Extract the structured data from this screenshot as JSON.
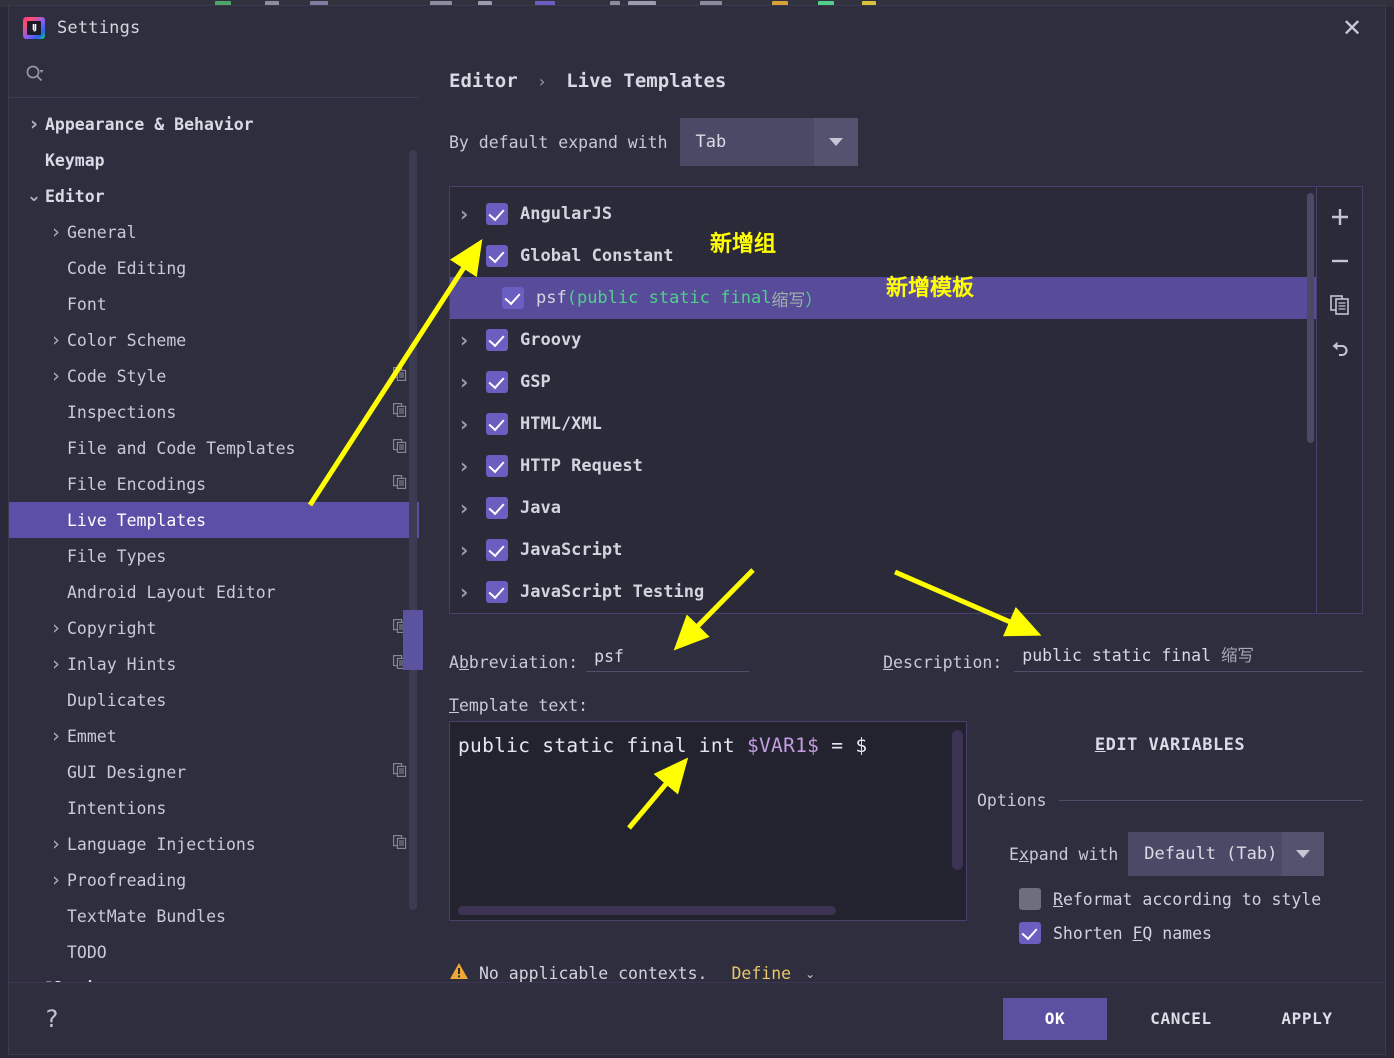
{
  "window": {
    "title": "Settings",
    "logo_text": "IJ",
    "close_icon": "close-icon"
  },
  "search": {
    "value": "",
    "placeholder": ""
  },
  "sidebar": {
    "items": [
      {
        "label": "Appearance & Behavior",
        "chevron": ">",
        "indent": 0,
        "bold": true,
        "selected": false,
        "copy": false
      },
      {
        "label": "Keymap",
        "chevron": "",
        "indent": 0,
        "bold": true,
        "selected": false,
        "copy": false
      },
      {
        "label": "Editor",
        "chevron": "v",
        "indent": 0,
        "bold": true,
        "selected": false,
        "copy": false
      },
      {
        "label": "General",
        "chevron": ">",
        "indent": 1,
        "bold": false,
        "selected": false,
        "copy": false
      },
      {
        "label": "Code Editing",
        "chevron": "",
        "indent": 1,
        "bold": false,
        "selected": false,
        "copy": false
      },
      {
        "label": "Font",
        "chevron": "",
        "indent": 1,
        "bold": false,
        "selected": false,
        "copy": false
      },
      {
        "label": "Color Scheme",
        "chevron": ">",
        "indent": 1,
        "bold": false,
        "selected": false,
        "copy": false
      },
      {
        "label": "Code Style",
        "chevron": ">",
        "indent": 1,
        "bold": false,
        "selected": false,
        "copy": true
      },
      {
        "label": "Inspections",
        "chevron": "",
        "indent": 1,
        "bold": false,
        "selected": false,
        "copy": true
      },
      {
        "label": "File and Code Templates",
        "chevron": "",
        "indent": 1,
        "bold": false,
        "selected": false,
        "copy": true
      },
      {
        "label": "File Encodings",
        "chevron": "",
        "indent": 1,
        "bold": false,
        "selected": false,
        "copy": true
      },
      {
        "label": "Live Templates",
        "chevron": "",
        "indent": 1,
        "bold": false,
        "selected": true,
        "copy": false
      },
      {
        "label": "File Types",
        "chevron": "",
        "indent": 1,
        "bold": false,
        "selected": false,
        "copy": false
      },
      {
        "label": "Android Layout Editor",
        "chevron": "",
        "indent": 1,
        "bold": false,
        "selected": false,
        "copy": false
      },
      {
        "label": "Copyright",
        "chevron": ">",
        "indent": 1,
        "bold": false,
        "selected": false,
        "copy": true
      },
      {
        "label": "Inlay Hints",
        "chevron": ">",
        "indent": 1,
        "bold": false,
        "selected": false,
        "copy": true
      },
      {
        "label": "Duplicates",
        "chevron": "",
        "indent": 1,
        "bold": false,
        "selected": false,
        "copy": false
      },
      {
        "label": "Emmet",
        "chevron": ">",
        "indent": 1,
        "bold": false,
        "selected": false,
        "copy": false
      },
      {
        "label": "GUI Designer",
        "chevron": "",
        "indent": 1,
        "bold": false,
        "selected": false,
        "copy": true
      },
      {
        "label": "Intentions",
        "chevron": "",
        "indent": 1,
        "bold": false,
        "selected": false,
        "copy": false
      },
      {
        "label": "Language Injections",
        "chevron": ">",
        "indent": 1,
        "bold": false,
        "selected": false,
        "copy": true
      },
      {
        "label": "Proofreading",
        "chevron": ">",
        "indent": 1,
        "bold": false,
        "selected": false,
        "copy": false
      },
      {
        "label": "TextMate Bundles",
        "chevron": "",
        "indent": 1,
        "bold": false,
        "selected": false,
        "copy": false
      },
      {
        "label": "TODO",
        "chevron": "",
        "indent": 1,
        "bold": false,
        "selected": false,
        "copy": false
      },
      {
        "label": "Plugins",
        "chevron": "",
        "indent": 0,
        "bold": true,
        "selected": false,
        "copy": false
      }
    ]
  },
  "breadcrumb": {
    "root": "Editor",
    "separator": "›",
    "leaf": "Live Templates"
  },
  "expand_default": {
    "label": "By default expand with",
    "value": "Tab"
  },
  "templates_list": {
    "rows": [
      {
        "kind": "group",
        "chevron": ">",
        "checked": true,
        "label": "AngularJS",
        "selected": false
      },
      {
        "kind": "group",
        "chevron": "v",
        "checked": true,
        "label": "Global Constant",
        "selected": false
      },
      {
        "kind": "template",
        "chevron": "",
        "checked": true,
        "abbr": "psf",
        "desc_open": " (public static final ",
        "desc_cjk": "缩写",
        "desc_close": "）",
        "selected": true
      },
      {
        "kind": "group",
        "chevron": ">",
        "checked": true,
        "label": "Groovy",
        "selected": false
      },
      {
        "kind": "group",
        "chevron": ">",
        "checked": true,
        "label": "GSP",
        "selected": false
      },
      {
        "kind": "group",
        "chevron": ">",
        "checked": true,
        "label": "HTML/XML",
        "selected": false
      },
      {
        "kind": "group",
        "chevron": ">",
        "checked": true,
        "label": "HTTP Request",
        "selected": false
      },
      {
        "kind": "group",
        "chevron": ">",
        "checked": true,
        "label": "Java",
        "selected": false
      },
      {
        "kind": "group",
        "chevron": ">",
        "checked": true,
        "label": "JavaScript",
        "selected": false
      },
      {
        "kind": "group",
        "chevron": ">",
        "checked": true,
        "label": "JavaScript Testing",
        "selected": false
      }
    ],
    "toolbar": [
      {
        "icon": "plus-icon",
        "glyph": "+"
      },
      {
        "icon": "minus-icon",
        "glyph": "−"
      },
      {
        "icon": "duplicate-icon",
        "glyph": "❐"
      },
      {
        "icon": "revert-icon",
        "glyph": "↩"
      }
    ]
  },
  "fields": {
    "abbreviation_label_pre": "A",
    "abbreviation_label_mn": "b",
    "abbreviation_label_post": "breviation:",
    "abbreviation_value": "psf",
    "description_label_mn": "D",
    "description_label_post": "escription:",
    "description_value_ascii": "public static final ",
    "description_value_cjk": "缩写",
    "template_text_label_mn": "T",
    "template_text_label_post": "emplate text:"
  },
  "editor": {
    "code_pre": "public static final int ",
    "code_var": "$VAR1$",
    "code_post": " = $"
  },
  "right_pane": {
    "edit_variables_mn": "E",
    "edit_variables_post": "DIT VARIABLES",
    "options_title": "Options",
    "expand_with_pre": "E",
    "expand_with_mn": "x",
    "expand_with_post": "pand with",
    "expand_with_value": "Default (Tab)",
    "reformat_pre": "",
    "reformat_mn": "R",
    "reformat_post": "eformat according to style",
    "reformat_checked": false,
    "shorten_pre": "Shorten ",
    "shorten_mn": "F",
    "shorten_post": "Q names",
    "shorten_checked": true
  },
  "context": {
    "warning_icon": "warning-triangle-icon",
    "message": "No applicable contexts.",
    "define_label": "Define",
    "define_chevron": "⌄"
  },
  "footer": {
    "help": "?",
    "ok": "OK",
    "cancel": "CANCEL",
    "apply": "APPLY"
  },
  "annotations": {
    "new_group": "新增组",
    "new_template": "新增模板",
    "arrow_color": "#ffff00"
  },
  "colors": {
    "accent": "#5c51a0",
    "selection": "#574b9a",
    "checkbox": "#6a5fc0",
    "desc_green": "#4fd08a",
    "var_purple": "#c49ce0",
    "annotation_yellow": "#ffff00",
    "define_link": "#e8c86a",
    "warning": "#f0a732"
  }
}
